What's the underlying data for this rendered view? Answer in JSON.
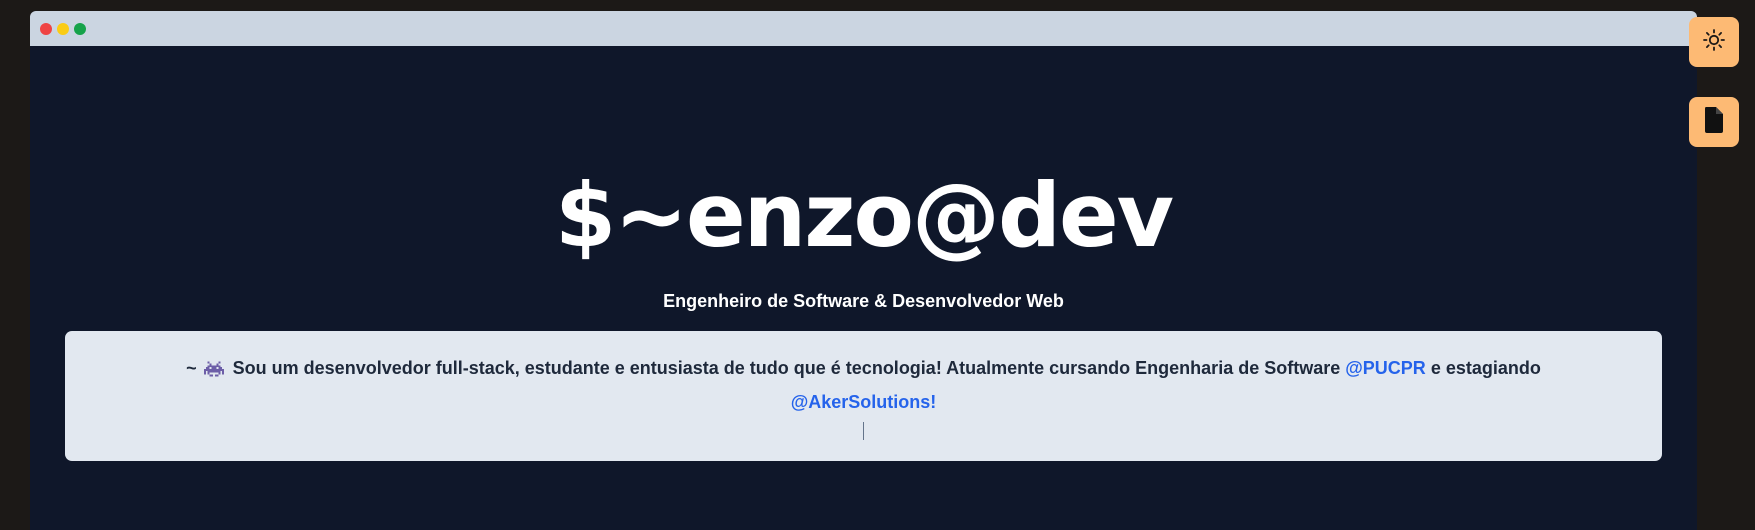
{
  "window": {
    "controls": [
      "close",
      "minimize",
      "maximize"
    ]
  },
  "hero": {
    "title": "$~enzo@dev",
    "subtitle": "Engenheiro de Software & Desenvolvedor Web"
  },
  "intro": {
    "prefix": "~",
    "icon": "space-invader-icon",
    "text": "Sou um desenvolvedor full-stack, estudante e entusiasta de tudo que é tecnologia! Atualmente cursando Engenharia de Software",
    "link_university": "@PUCPR",
    "connector": "e estagiando",
    "link_company": "@AkerSolutions!"
  },
  "side_buttons": {
    "theme_icon": "sun-icon",
    "resume_icon": "document-icon"
  },
  "colors": {
    "background": "#0f172a",
    "titlebar": "#cbd5e1",
    "accent_button": "#fdba74",
    "link": "#2563eb",
    "card": "#e2e8f0"
  }
}
